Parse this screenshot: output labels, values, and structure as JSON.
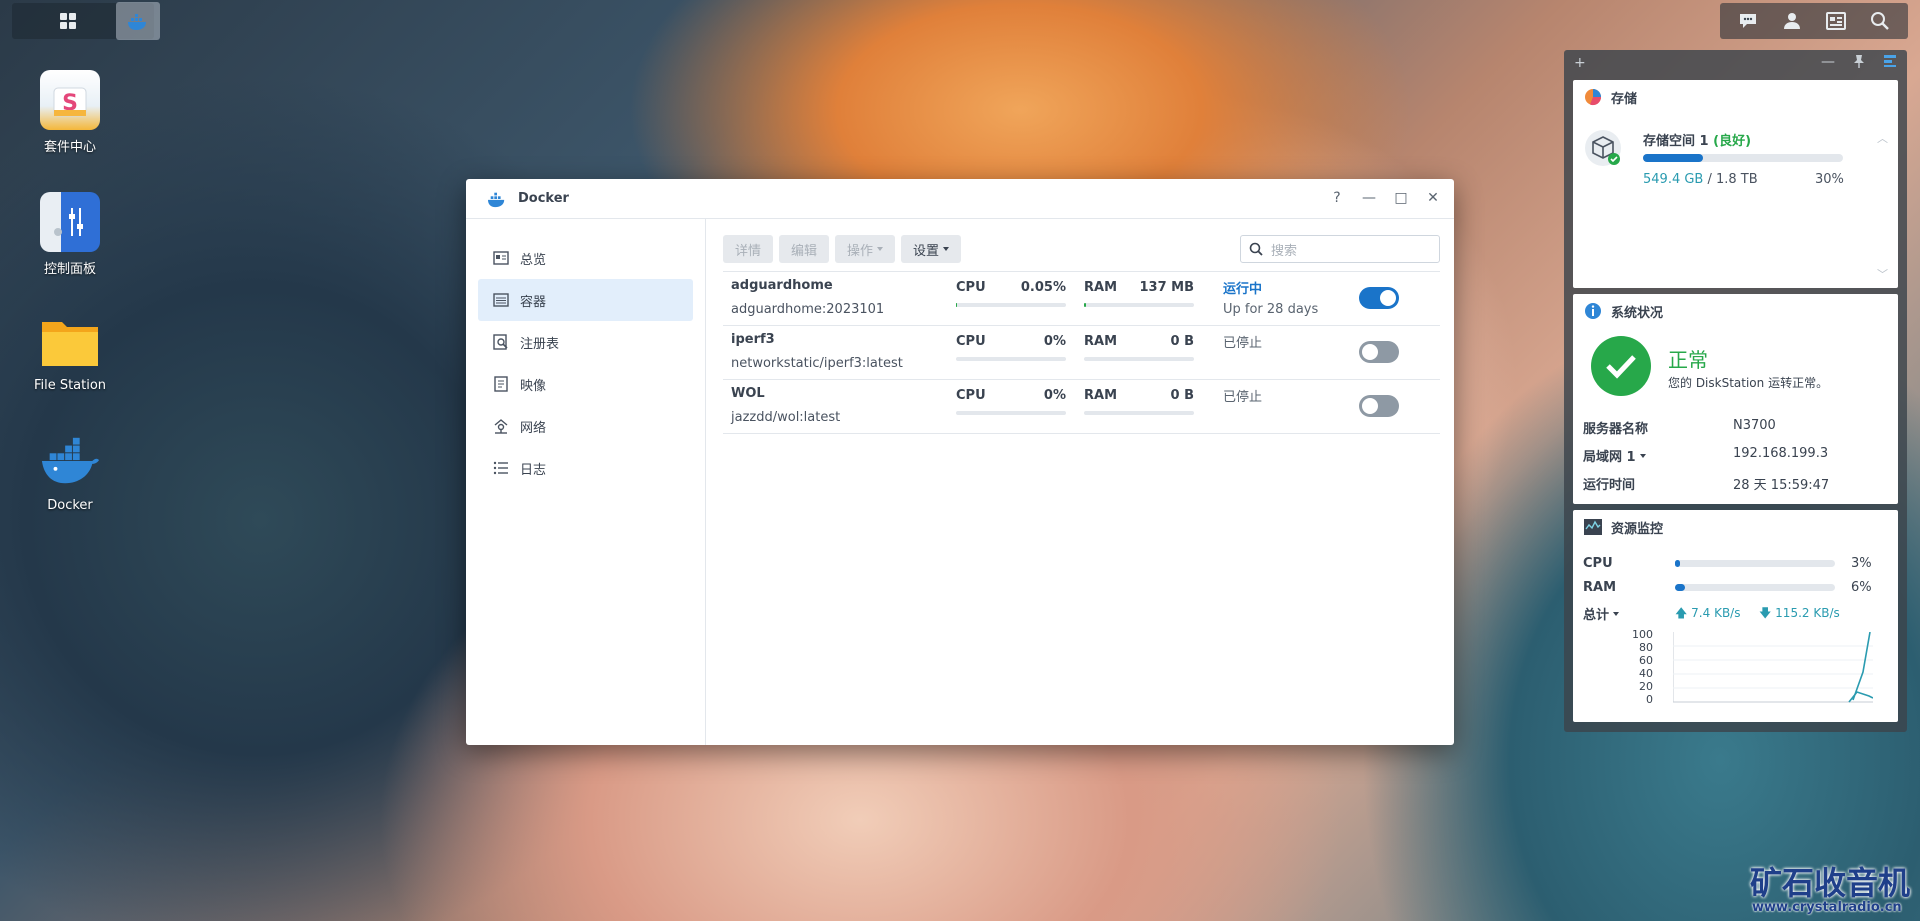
{
  "desktop": {
    "icons": [
      {
        "label": "套件中心",
        "icon": "package-center-icon"
      },
      {
        "label": "控制面板",
        "icon": "control-panel-icon"
      },
      {
        "label": "File Station",
        "icon": "folder-icon"
      },
      {
        "label": "Docker",
        "icon": "docker-whale-icon"
      }
    ],
    "watermark_line1": "矿石收音机",
    "watermark_line2": "www.crystalradio.cn"
  },
  "window": {
    "title": "Docker",
    "controls": [
      "?",
      "—",
      "□",
      "✕"
    ],
    "nav": [
      {
        "label": "总览",
        "icon": "overview-icon"
      },
      {
        "label": "容器",
        "icon": "container-list-icon",
        "active": true
      },
      {
        "label": "注册表",
        "icon": "registry-search-icon"
      },
      {
        "label": "映像",
        "icon": "image-icon"
      },
      {
        "label": "网络",
        "icon": "network-icon"
      },
      {
        "label": "日志",
        "icon": "log-icon"
      }
    ],
    "toolbar": {
      "details": "详情",
      "edit": "编辑",
      "action": "操作",
      "settings": "设置"
    },
    "search": {
      "placeholder": "搜索"
    },
    "containers": [
      {
        "name": "adguardhome",
        "image": "adguardhome:2023101",
        "cpu_label": "CPU",
        "cpu": "0.05%",
        "cpu_fraction": 0.005,
        "ram_label": "RAM",
        "ram": "137 MB",
        "ram_fraction": 0.02,
        "status": "运行中",
        "uptime": "Up for 28 days",
        "running": true
      },
      {
        "name": "iperf3",
        "image": "networkstatic/iperf3:latest",
        "cpu_label": "CPU",
        "cpu": "0%",
        "cpu_fraction": 0,
        "ram_label": "RAM",
        "ram": "0 B",
        "ram_fraction": 0,
        "status": "已停止",
        "uptime": "",
        "running": false
      },
      {
        "name": "WOL",
        "image": "jazzdd/wol:latest",
        "cpu_label": "CPU",
        "cpu": "0%",
        "cpu_fraction": 0,
        "ram_label": "RAM",
        "ram": "0 B",
        "ram_fraction": 0,
        "status": "已停止",
        "uptime": "",
        "running": false
      }
    ]
  },
  "widgets": {
    "panel_controls": [
      "+",
      "—",
      "pin",
      "layout"
    ],
    "storage": {
      "title": "存储",
      "volume_name": "存储空间 1",
      "volume_status": "良好",
      "used": "549.4 GB",
      "total": "1.8 TB",
      "percent": "30%",
      "fraction": 0.3
    },
    "system": {
      "title": "系统状况",
      "status": "正常",
      "message": "您的 DiskStation 运转正常。",
      "rows": [
        {
          "key": "服务器名称",
          "value": "N3700"
        },
        {
          "key": "局域网 1",
          "value": "192.168.199.3"
        },
        {
          "key": "运行时间",
          "value": "28 天 15:59:47"
        }
      ]
    },
    "resource": {
      "title": "资源监控",
      "cpu_label": "CPU",
      "cpu": "3%",
      "cpu_fraction": 0.03,
      "ram_label": "RAM",
      "ram": "6%",
      "ram_fraction": 0.06,
      "total_label": "总计",
      "upload": "7.4 KB/s",
      "download": "115.2 KB/s",
      "y_ticks": [
        "100",
        "80",
        "60",
        "40",
        "20",
        "0"
      ]
    }
  },
  "colors": {
    "accent": "#1a74c9",
    "ok_green": "#27a84a",
    "teal": "#2a9bb0"
  }
}
